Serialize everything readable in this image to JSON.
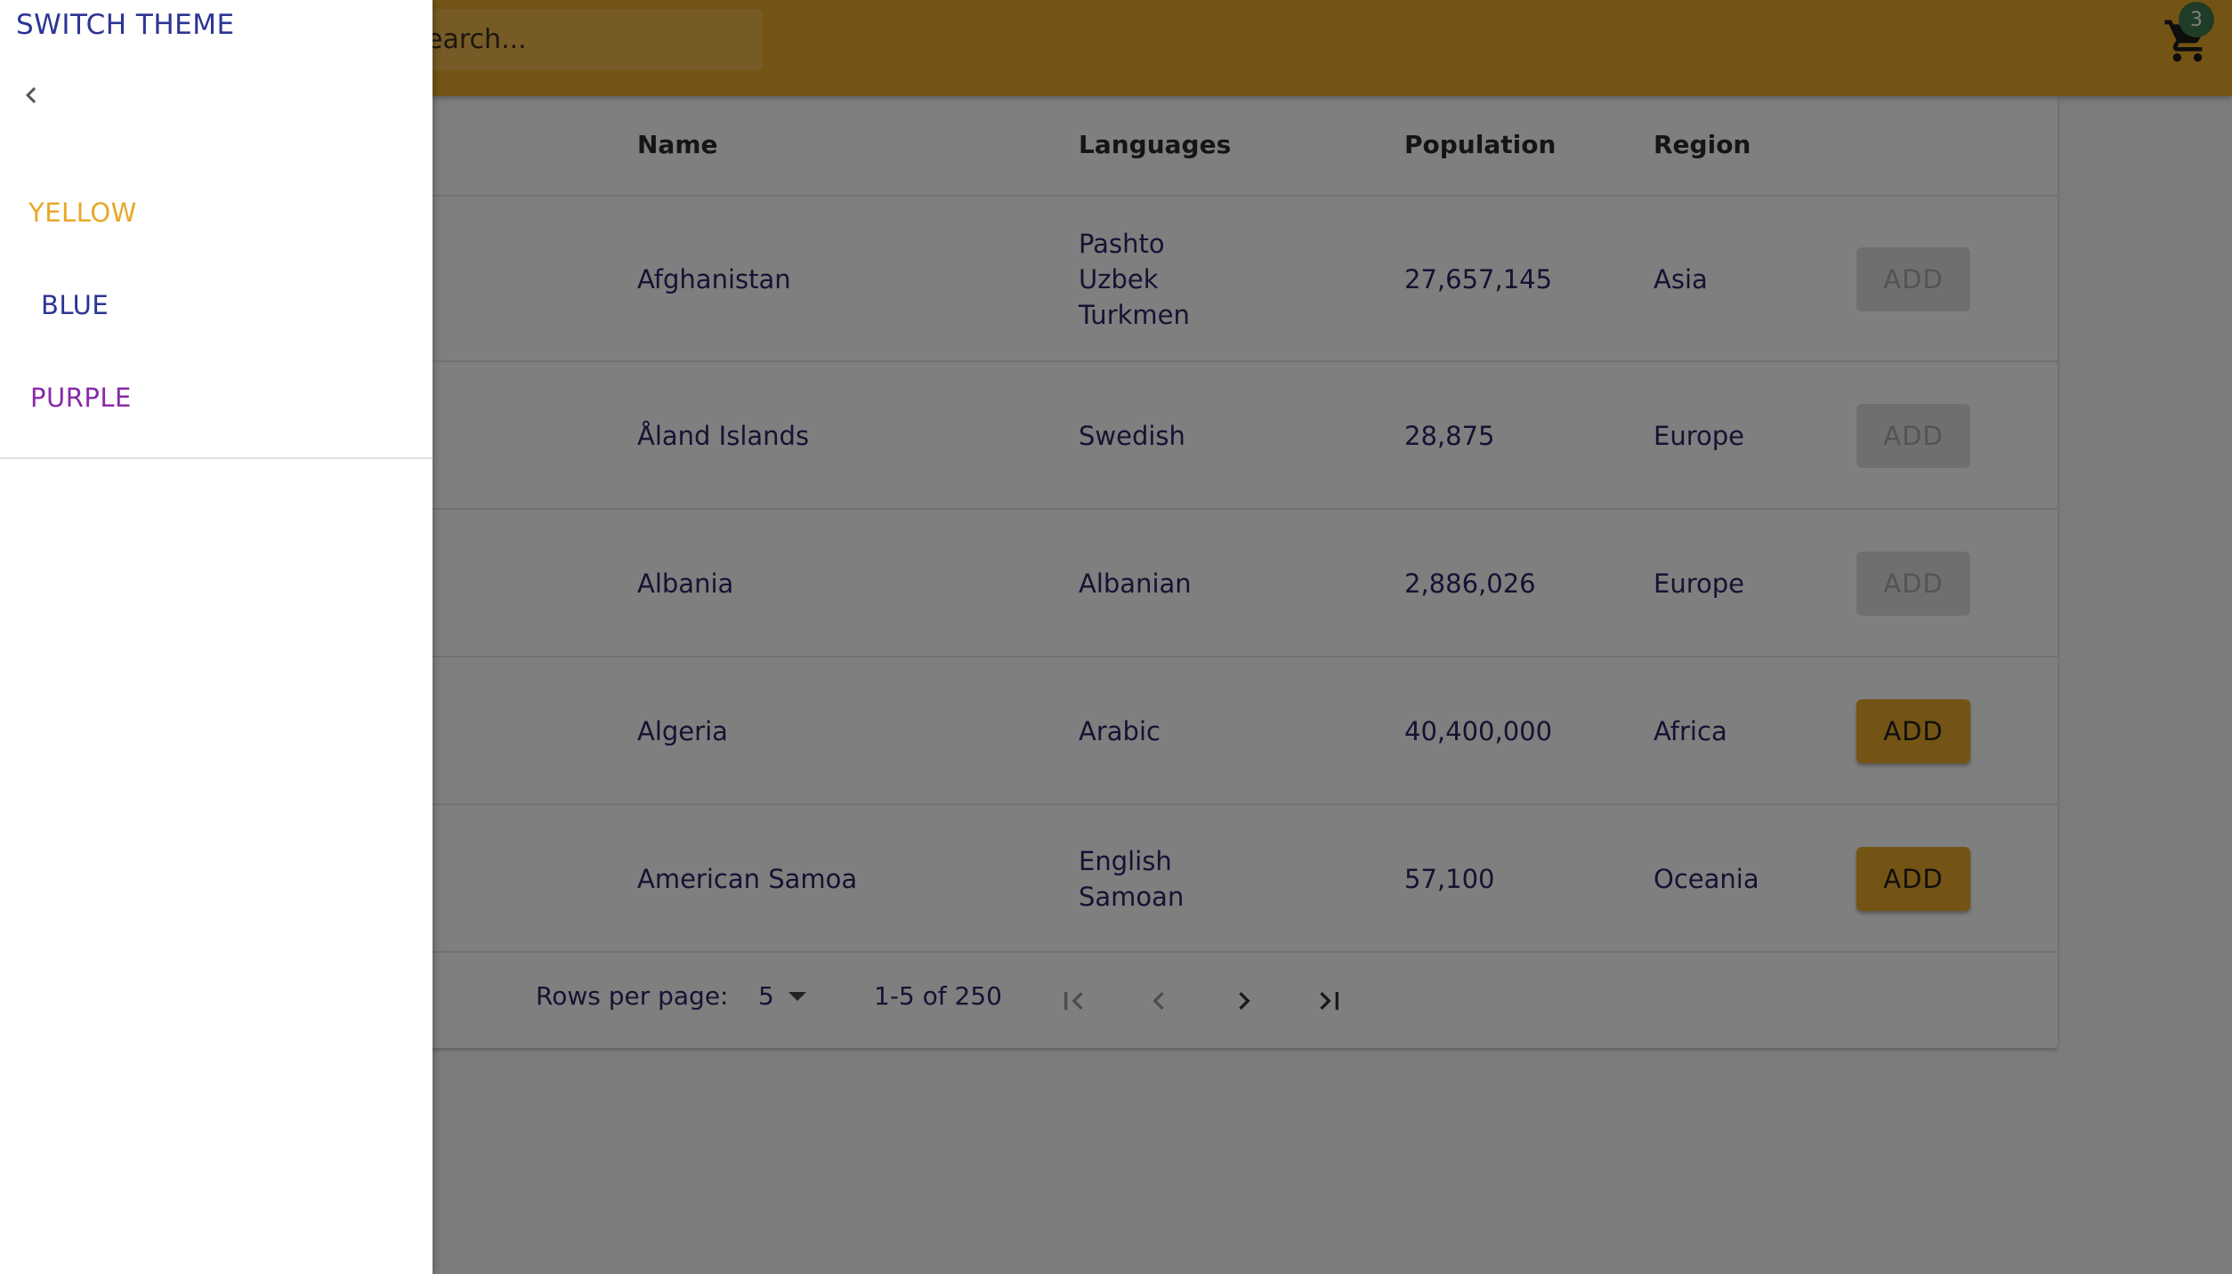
{
  "header": {
    "search_placeholder": "Search...",
    "cart_count": "3",
    "accent_color": "#e8a829"
  },
  "table": {
    "columns": [
      "Name",
      "Languages",
      "Population",
      "Region"
    ],
    "rows": [
      {
        "name": "Afghanistan",
        "languages": [
          "Pashto",
          "Uzbek",
          "Turkmen"
        ],
        "population": "27,657,145",
        "region": "Asia",
        "add_label": "ADD",
        "add_enabled": false
      },
      {
        "name": "Åland Islands",
        "languages": [
          "Swedish"
        ],
        "population": "28,875",
        "region": "Europe",
        "add_label": "ADD",
        "add_enabled": false
      },
      {
        "name": "Albania",
        "languages": [
          "Albanian"
        ],
        "population": "2,886,026",
        "region": "Europe",
        "add_label": "ADD",
        "add_enabled": false
      },
      {
        "name": "Algeria",
        "languages": [
          "Arabic"
        ],
        "population": "40,400,000",
        "region": "Africa",
        "add_label": "ADD",
        "add_enabled": true
      },
      {
        "name": "American Samoa",
        "languages": [
          "English",
          "Samoan"
        ],
        "population": "57,100",
        "region": "Oceania",
        "add_label": "ADD",
        "add_enabled": true
      }
    ]
  },
  "pagination": {
    "rows_per_page_label": "Rows per page:",
    "rows_per_page_value": "5",
    "range_label": "1-5 of 250"
  },
  "drawer": {
    "title": "SWITCH THEME",
    "themes": [
      {
        "label": "YELLOW",
        "color": "#e8a829"
      },
      {
        "label": "BLUE",
        "color": "#2b3595"
      },
      {
        "label": "PURPLE",
        "color": "#8a2aa8"
      }
    ]
  },
  "icons": {
    "back": "chevron-left-icon",
    "cart": "shopping-cart-icon",
    "first_page": "first-page-icon",
    "prev_page": "chevron-left-icon",
    "next_page": "chevron-right-icon",
    "last_page": "last-page-icon"
  }
}
